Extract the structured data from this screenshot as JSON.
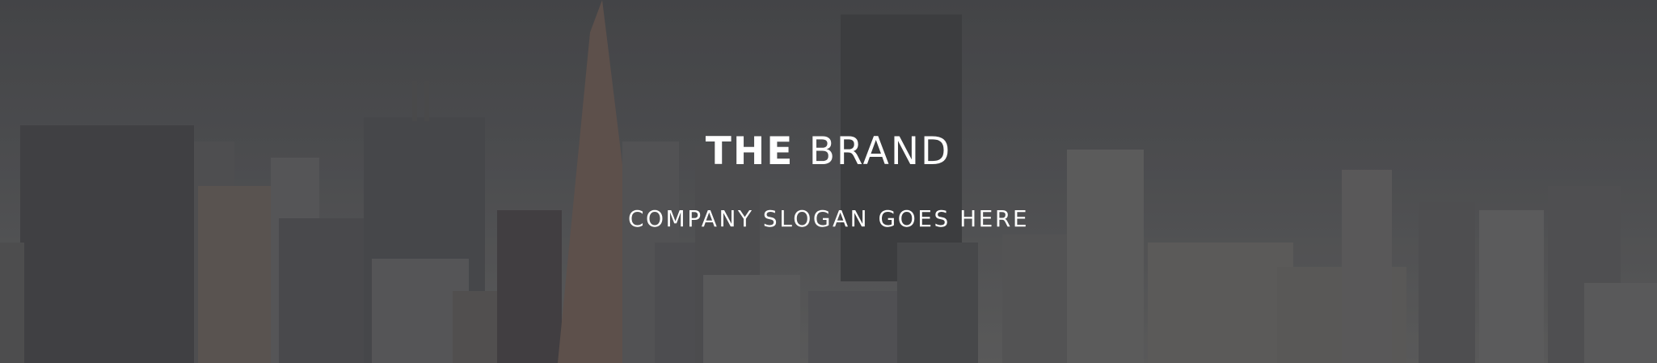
{
  "hero": {
    "title_bold": "THE",
    "title_light": "BRAND",
    "slogan": "COMPANY SLOGAN GOES HERE"
  }
}
